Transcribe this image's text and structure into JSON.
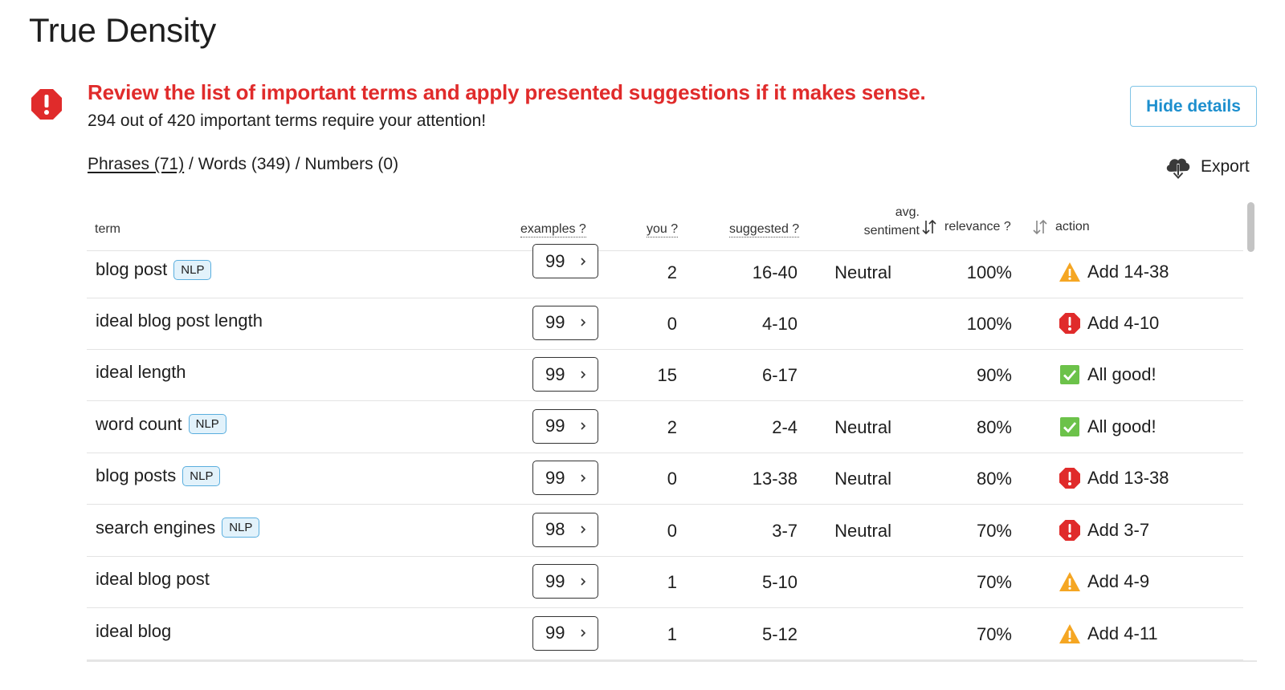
{
  "page": {
    "title": "True Density"
  },
  "alert": {
    "heading": "Review the list of important terms and apply presented suggestions if it makes sense.",
    "subtext": "294 out of 420 important terms require your attention!",
    "icon": "alert-octagon-icon",
    "color": "#e02b2b"
  },
  "buttons": {
    "hide_details": "Hide details",
    "export": "Export"
  },
  "filters": {
    "phrases": "Phrases (71)",
    "sep1": " / ",
    "words": "Words (349)",
    "sep2": " / ",
    "numbers": "Numbers (0)"
  },
  "table": {
    "headers": {
      "term": "term",
      "examples": "examples ?",
      "you": "you ?",
      "suggested": "suggested ?",
      "sentiment_line1": "avg.",
      "sentiment_line2": "sentiment",
      "relevance": "relevance ?",
      "action": "action"
    },
    "rows": [
      {
        "term": "blog post",
        "nlp": "NLP",
        "examples": "99",
        "you": "2",
        "suggested": "16-40",
        "sentiment": "Neutral",
        "relevance": "100%",
        "status": "warning",
        "action": "Add 14-38"
      },
      {
        "term": "ideal blog post length",
        "nlp": "",
        "examples": "99",
        "you": "0",
        "suggested": "4-10",
        "sentiment": "",
        "relevance": "100%",
        "status": "error",
        "action": "Add 4-10"
      },
      {
        "term": "ideal length",
        "nlp": "",
        "examples": "99",
        "you": "15",
        "suggested": "6-17",
        "sentiment": "",
        "relevance": "90%",
        "status": "ok",
        "action": "All good!"
      },
      {
        "term": "word count",
        "nlp": "NLP",
        "examples": "99",
        "you": "2",
        "suggested": "2-4",
        "sentiment": "Neutral",
        "relevance": "80%",
        "status": "ok",
        "action": "All good!"
      },
      {
        "term": "blog posts",
        "nlp": "NLP",
        "examples": "99",
        "you": "0",
        "suggested": "13-38",
        "sentiment": "Neutral",
        "relevance": "80%",
        "status": "error",
        "action": "Add 13-38"
      },
      {
        "term": "search engines",
        "nlp": "NLP",
        "examples": "98",
        "you": "0",
        "suggested": "3-7",
        "sentiment": "Neutral",
        "relevance": "70%",
        "status": "error",
        "action": "Add 3-7"
      },
      {
        "term": "ideal blog post",
        "nlp": "",
        "examples": "99",
        "you": "1",
        "suggested": "5-10",
        "sentiment": "",
        "relevance": "70%",
        "status": "warning",
        "action": "Add 4-9"
      },
      {
        "term": "ideal blog",
        "nlp": "",
        "examples": "99",
        "you": "1",
        "suggested": "5-12",
        "sentiment": "",
        "relevance": "70%",
        "status": "warning",
        "action": "Add 4-11"
      }
    ]
  },
  "colors": {
    "error": "#e02b2b",
    "warning": "#f5a623",
    "ok": "#6cc24a",
    "link": "#1d8fce",
    "nlp_bg": "#e2f2fb",
    "nlp_border": "#5aaede"
  }
}
